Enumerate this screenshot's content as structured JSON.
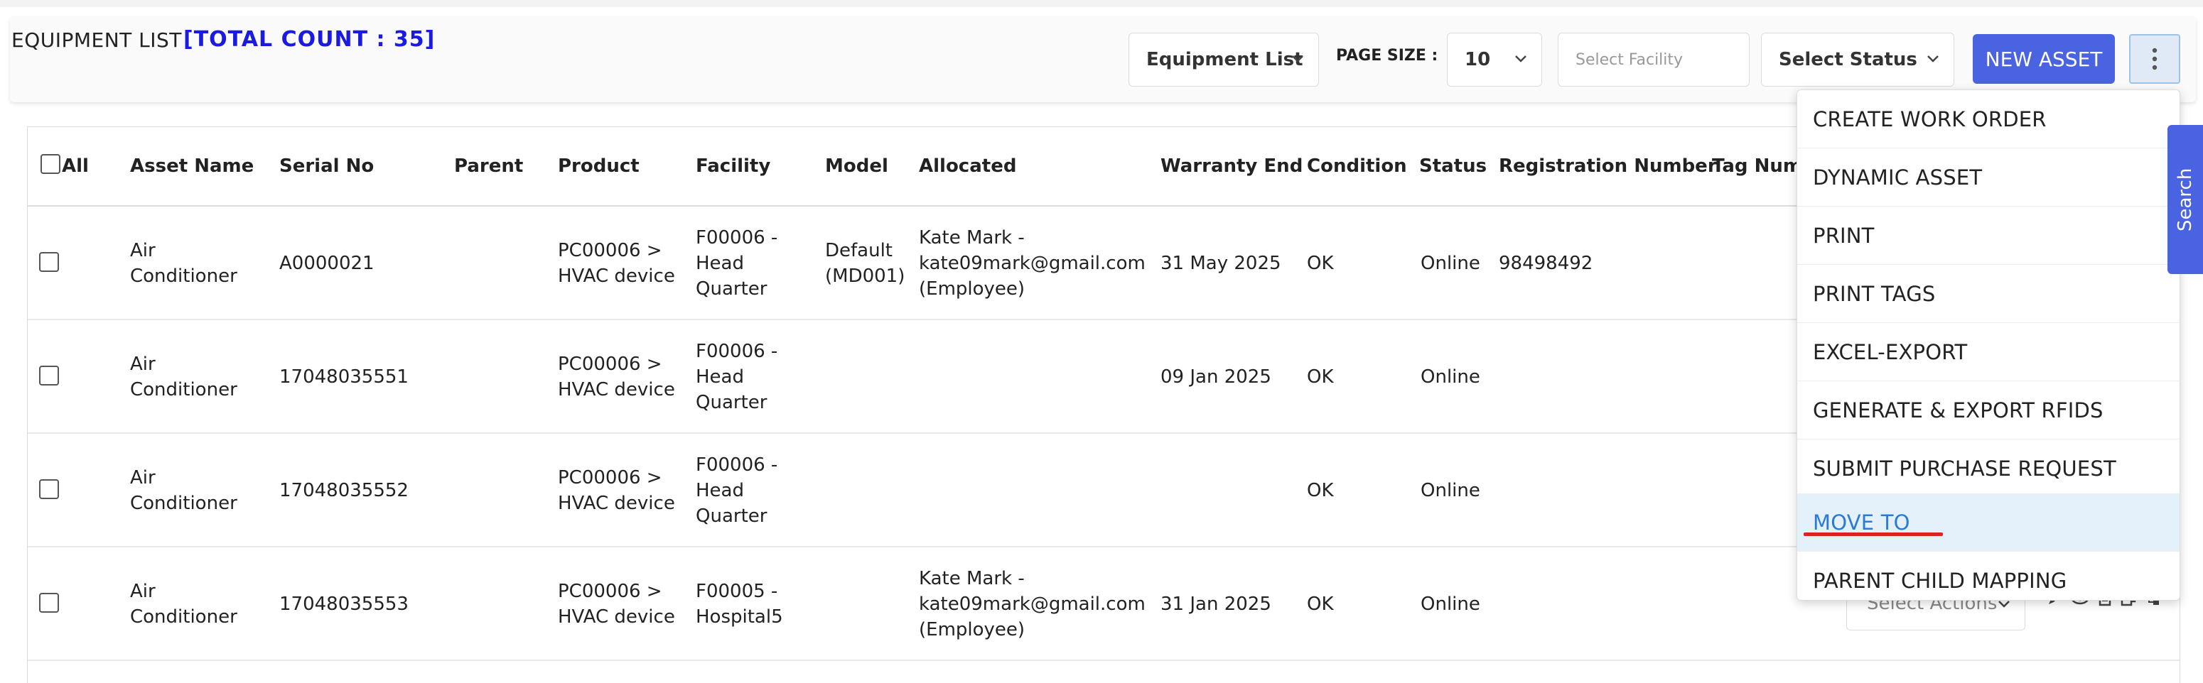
{
  "header": {
    "title": "EQUIPMENT LIST",
    "count_label": "[TOTAL COUNT : 35]",
    "list_select": "Equipment List",
    "page_size_label": "PAGE SIZE :",
    "page_size_value": "10",
    "facility_placeholder": "Select Facility",
    "status_select": "Select Status",
    "new_asset": "NEW ASSET"
  },
  "table": {
    "columns": [
      "All",
      "Asset Name",
      "Serial No",
      "Parent",
      "Product",
      "Facility",
      "Model",
      "Allocated",
      "Warranty End",
      "Condition",
      "Status",
      "Registration Number",
      "Tag Numb"
    ],
    "rows": [
      {
        "asset_name": [
          "Air",
          "Conditioner"
        ],
        "serial": "A0000021",
        "parent": "",
        "product": [
          "PC00006 >",
          "HVAC device"
        ],
        "facility": [
          "F00006 -",
          "Head",
          "Quarter"
        ],
        "model": [
          "Default",
          "(MD001)"
        ],
        "allocated": [
          "Kate Mark -",
          "kate09mark@gmail.com",
          "(Employee)"
        ],
        "warranty_end": "31 May 2025",
        "condition": "OK",
        "status": "Online",
        "registration": "98498492"
      },
      {
        "asset_name": [
          "Air",
          "Conditioner"
        ],
        "serial": "17048035551",
        "parent": "",
        "product": [
          "PC00006 >",
          "HVAC device"
        ],
        "facility": [
          "F00006 -",
          "Head",
          "Quarter"
        ],
        "model": [],
        "allocated": [],
        "warranty_end": "09 Jan 2025",
        "condition": "OK",
        "status": "Online",
        "registration": ""
      },
      {
        "asset_name": [
          "Air",
          "Conditioner"
        ],
        "serial": "17048035552",
        "parent": "",
        "product": [
          "PC00006 >",
          "HVAC device"
        ],
        "facility": [
          "F00006 -",
          "Head",
          "Quarter"
        ],
        "model": [],
        "allocated": [],
        "warranty_end": "",
        "condition": "OK",
        "status": "Online",
        "registration": ""
      },
      {
        "asset_name": [
          "Air",
          "Conditioner"
        ],
        "serial": "17048035553",
        "parent": "",
        "product": [
          "PC00006 >",
          "HVAC device"
        ],
        "facility": [
          "F00005 -",
          "Hospital5"
        ],
        "model": [],
        "allocated": [
          "Kate Mark -",
          "kate09mark@gmail.com",
          "(Employee)"
        ],
        "warranty_end": "31 Jan 2025",
        "condition": "OK",
        "status": "Online",
        "registration": ""
      }
    ],
    "row_action_placeholder": "Select Actions"
  },
  "menu": {
    "items": [
      "CREATE WORK ORDER",
      "DYNAMIC ASSET",
      "PRINT",
      "PRINT TAGS",
      "EXCEL-EXPORT",
      "GENERATE & EXPORT RFIDS",
      "SUBMIT PURCHASE REQUEST",
      "MOVE TO",
      "PARENT CHILD MAPPING"
    ],
    "active_item": "MOVE TO"
  },
  "search_tab": "Search",
  "colors": {
    "accent": "#4a63e0",
    "count_blue": "#1a1ae0",
    "active_text": "#2a7ad6",
    "active_bg": "#e4f1fb",
    "highlight_underline": "#e02020"
  }
}
